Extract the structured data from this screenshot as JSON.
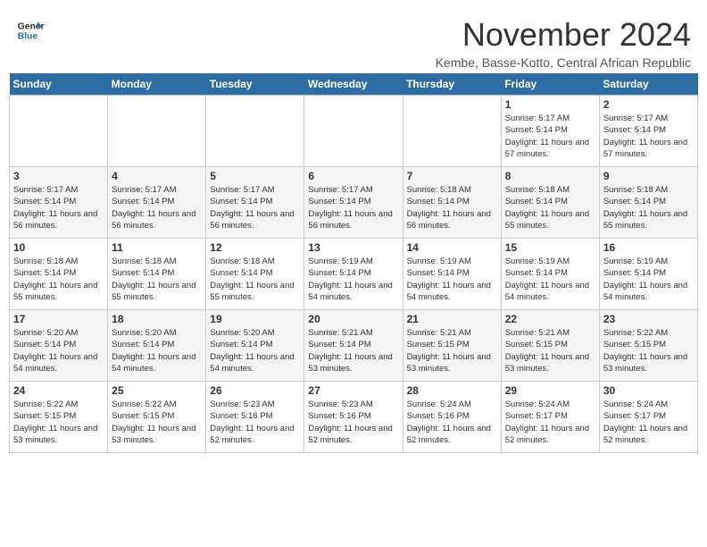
{
  "logo": {
    "line1": "General",
    "line2": "Blue"
  },
  "title": "November 2024",
  "subtitle": "Kembe, Basse-Kotto, Central African Republic",
  "weekdays": [
    "Sunday",
    "Monday",
    "Tuesday",
    "Wednesday",
    "Thursday",
    "Friday",
    "Saturday"
  ],
  "weeks": [
    [
      {
        "day": "",
        "sunrise": "",
        "sunset": "",
        "daylight": ""
      },
      {
        "day": "",
        "sunrise": "",
        "sunset": "",
        "daylight": ""
      },
      {
        "day": "",
        "sunrise": "",
        "sunset": "",
        "daylight": ""
      },
      {
        "day": "",
        "sunrise": "",
        "sunset": "",
        "daylight": ""
      },
      {
        "day": "",
        "sunrise": "",
        "sunset": "",
        "daylight": ""
      },
      {
        "day": "1",
        "sunrise": "Sunrise: 5:17 AM",
        "sunset": "Sunset: 5:14 PM",
        "daylight": "Daylight: 11 hours and 57 minutes."
      },
      {
        "day": "2",
        "sunrise": "Sunrise: 5:17 AM",
        "sunset": "Sunset: 5:14 PM",
        "daylight": "Daylight: 11 hours and 57 minutes."
      }
    ],
    [
      {
        "day": "3",
        "sunrise": "Sunrise: 5:17 AM",
        "sunset": "Sunset: 5:14 PM",
        "daylight": "Daylight: 11 hours and 56 minutes."
      },
      {
        "day": "4",
        "sunrise": "Sunrise: 5:17 AM",
        "sunset": "Sunset: 5:14 PM",
        "daylight": "Daylight: 11 hours and 56 minutes."
      },
      {
        "day": "5",
        "sunrise": "Sunrise: 5:17 AM",
        "sunset": "Sunset: 5:14 PM",
        "daylight": "Daylight: 11 hours and 56 minutes."
      },
      {
        "day": "6",
        "sunrise": "Sunrise: 5:17 AM",
        "sunset": "Sunset: 5:14 PM",
        "daylight": "Daylight: 11 hours and 56 minutes."
      },
      {
        "day": "7",
        "sunrise": "Sunrise: 5:18 AM",
        "sunset": "Sunset: 5:14 PM",
        "daylight": "Daylight: 11 hours and 56 minutes."
      },
      {
        "day": "8",
        "sunrise": "Sunrise: 5:18 AM",
        "sunset": "Sunset: 5:14 PM",
        "daylight": "Daylight: 11 hours and 55 minutes."
      },
      {
        "day": "9",
        "sunrise": "Sunrise: 5:18 AM",
        "sunset": "Sunset: 5:14 PM",
        "daylight": "Daylight: 11 hours and 55 minutes."
      }
    ],
    [
      {
        "day": "10",
        "sunrise": "Sunrise: 5:18 AM",
        "sunset": "Sunset: 5:14 PM",
        "daylight": "Daylight: 11 hours and 55 minutes."
      },
      {
        "day": "11",
        "sunrise": "Sunrise: 5:18 AM",
        "sunset": "Sunset: 5:14 PM",
        "daylight": "Daylight: 11 hours and 55 minutes."
      },
      {
        "day": "12",
        "sunrise": "Sunrise: 5:18 AM",
        "sunset": "Sunset: 5:14 PM",
        "daylight": "Daylight: 11 hours and 55 minutes."
      },
      {
        "day": "13",
        "sunrise": "Sunrise: 5:19 AM",
        "sunset": "Sunset: 5:14 PM",
        "daylight": "Daylight: 11 hours and 54 minutes."
      },
      {
        "day": "14",
        "sunrise": "Sunrise: 5:19 AM",
        "sunset": "Sunset: 5:14 PM",
        "daylight": "Daylight: 11 hours and 54 minutes."
      },
      {
        "day": "15",
        "sunrise": "Sunrise: 5:19 AM",
        "sunset": "Sunset: 5:14 PM",
        "daylight": "Daylight: 11 hours and 54 minutes."
      },
      {
        "day": "16",
        "sunrise": "Sunrise: 5:19 AM",
        "sunset": "Sunset: 5:14 PM",
        "daylight": "Daylight: 11 hours and 54 minutes."
      }
    ],
    [
      {
        "day": "17",
        "sunrise": "Sunrise: 5:20 AM",
        "sunset": "Sunset: 5:14 PM",
        "daylight": "Daylight: 11 hours and 54 minutes."
      },
      {
        "day": "18",
        "sunrise": "Sunrise: 5:20 AM",
        "sunset": "Sunset: 5:14 PM",
        "daylight": "Daylight: 11 hours and 54 minutes."
      },
      {
        "day": "19",
        "sunrise": "Sunrise: 5:20 AM",
        "sunset": "Sunset: 5:14 PM",
        "daylight": "Daylight: 11 hours and 54 minutes."
      },
      {
        "day": "20",
        "sunrise": "Sunrise: 5:21 AM",
        "sunset": "Sunset: 5:14 PM",
        "daylight": "Daylight: 11 hours and 53 minutes."
      },
      {
        "day": "21",
        "sunrise": "Sunrise: 5:21 AM",
        "sunset": "Sunset: 5:15 PM",
        "daylight": "Daylight: 11 hours and 53 minutes."
      },
      {
        "day": "22",
        "sunrise": "Sunrise: 5:21 AM",
        "sunset": "Sunset: 5:15 PM",
        "daylight": "Daylight: 11 hours and 53 minutes."
      },
      {
        "day": "23",
        "sunrise": "Sunrise: 5:22 AM",
        "sunset": "Sunset: 5:15 PM",
        "daylight": "Daylight: 11 hours and 53 minutes."
      }
    ],
    [
      {
        "day": "24",
        "sunrise": "Sunrise: 5:22 AM",
        "sunset": "Sunset: 5:15 PM",
        "daylight": "Daylight: 11 hours and 53 minutes."
      },
      {
        "day": "25",
        "sunrise": "Sunrise: 5:22 AM",
        "sunset": "Sunset: 5:15 PM",
        "daylight": "Daylight: 11 hours and 53 minutes."
      },
      {
        "day": "26",
        "sunrise": "Sunrise: 5:23 AM",
        "sunset": "Sunset: 5:16 PM",
        "daylight": "Daylight: 11 hours and 52 minutes."
      },
      {
        "day": "27",
        "sunrise": "Sunrise: 5:23 AM",
        "sunset": "Sunset: 5:16 PM",
        "daylight": "Daylight: 11 hours and 52 minutes."
      },
      {
        "day": "28",
        "sunrise": "Sunrise: 5:24 AM",
        "sunset": "Sunset: 5:16 PM",
        "daylight": "Daylight: 11 hours and 52 minutes."
      },
      {
        "day": "29",
        "sunrise": "Sunrise: 5:24 AM",
        "sunset": "Sunset: 5:17 PM",
        "daylight": "Daylight: 11 hours and 52 minutes."
      },
      {
        "day": "30",
        "sunrise": "Sunrise: 5:24 AM",
        "sunset": "Sunset: 5:17 PM",
        "daylight": "Daylight: 11 hours and 52 minutes."
      }
    ]
  ]
}
